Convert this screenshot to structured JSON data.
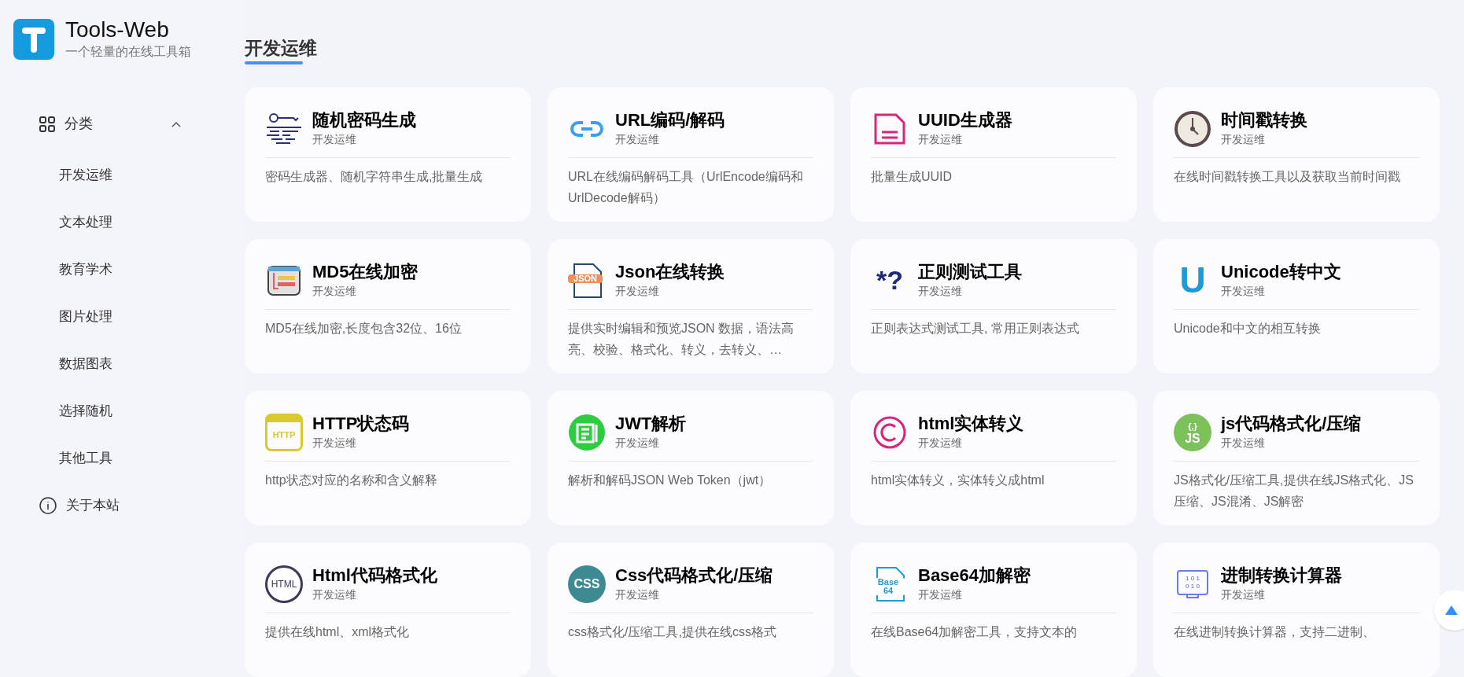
{
  "brand": {
    "name": "Tools-Web",
    "tagline": "一个轻量的在线工具箱"
  },
  "sidebar": {
    "category": {
      "label": "分类",
      "expanded": true
    },
    "items": [
      {
        "label": "开发运维"
      },
      {
        "label": "文本处理"
      },
      {
        "label": "教育学术"
      },
      {
        "label": "图片处理"
      },
      {
        "label": "数据图表"
      },
      {
        "label": "选择随机"
      },
      {
        "label": "其他工具"
      }
    ],
    "about": {
      "label": "关于本站"
    }
  },
  "section_title": "开发运维",
  "tools": [
    {
      "kind": "password",
      "title": "随机密码生成",
      "category": "开发运维",
      "description": "密码生成器、随机字符串生成,批量生成"
    },
    {
      "kind": "link",
      "title": "URL编码/解码",
      "category": "开发运维",
      "description": "URL在线编码解码工具（UrlEncode编码和 UrlDecode解码）"
    },
    {
      "kind": "document",
      "title": "UUID生成器",
      "category": "开发运维",
      "description": "批量生成UUID"
    },
    {
      "kind": "clock",
      "title": "时间戳转换",
      "category": "开发运维",
      "description": "在线时间戳转换工具以及获取当前时间戳"
    },
    {
      "kind": "window",
      "title": "MD5在线加密",
      "category": "开发运维",
      "description": "MD5在线加密,长度包含32位、16位"
    },
    {
      "kind": "file",
      "icon_label": [
        "JSON"
      ],
      "title": "Json在线转换",
      "category": "开发运维",
      "description": "提供实时编辑和预览JSON 数据，语法高亮、校验、格式化、转义，去转义、…"
    },
    {
      "kind": "regex",
      "icon_label": [
        "*?"
      ],
      "title": "正则测试工具",
      "category": "开发运维",
      "description": "正则表达式测试工具, 常用正则表达式"
    },
    {
      "kind": "letter",
      "icon_label": [
        "U"
      ],
      "title": "Unicode转中文",
      "category": "开发运维",
      "description": "Unicode和中文的相互转换"
    },
    {
      "kind": "browser",
      "icon_label": [
        "HTTP"
      ],
      "title": "HTTP状态码",
      "category": "开发运维",
      "description": "http状态对应的名称和含义解释"
    },
    {
      "kind": "list",
      "title": "JWT解析",
      "category": "开发运维",
      "description": "解析和解码JSON Web Token（jwt）"
    },
    {
      "kind": "copyright",
      "title": "html实体转义",
      "category": "开发运维",
      "description": "html实体转义，实体转义成html"
    },
    {
      "kind": "badge",
      "icon_label": [
        "{,}",
        "JS"
      ],
      "color": "#7cc15a",
      "title": "js代码格式化/压缩",
      "category": "开发运维",
      "description": "JS格式化/压缩工具,提供在线JS格式化、JS压缩、JS混淆、JS解密"
    },
    {
      "kind": "ring",
      "icon_label": [
        "HTML"
      ],
      "title": "Html代码格式化",
      "category": "开发运维",
      "description": "提供在线html、xml格式化"
    },
    {
      "kind": "badge",
      "icon_label": [
        "CSS"
      ],
      "color": "#3e8a92",
      "title": "Css代码格式化/压缩",
      "category": "开发运维",
      "description": "css格式化/压缩工具,提供在线css格式"
    },
    {
      "kind": "file",
      "icon_label": [
        "Base",
        "64"
      ],
      "title": "Base64加解密",
      "category": "开发运维",
      "description": "在线Base64加解密工具，支持文本的"
    },
    {
      "kind": "monitor",
      "icon_label": [
        "1 0 1",
        "0 1 0"
      ],
      "title": "进制转换计算器",
      "category": "开发运维",
      "description": "在线进制转换计算器，支持二进制、"
    }
  ]
}
